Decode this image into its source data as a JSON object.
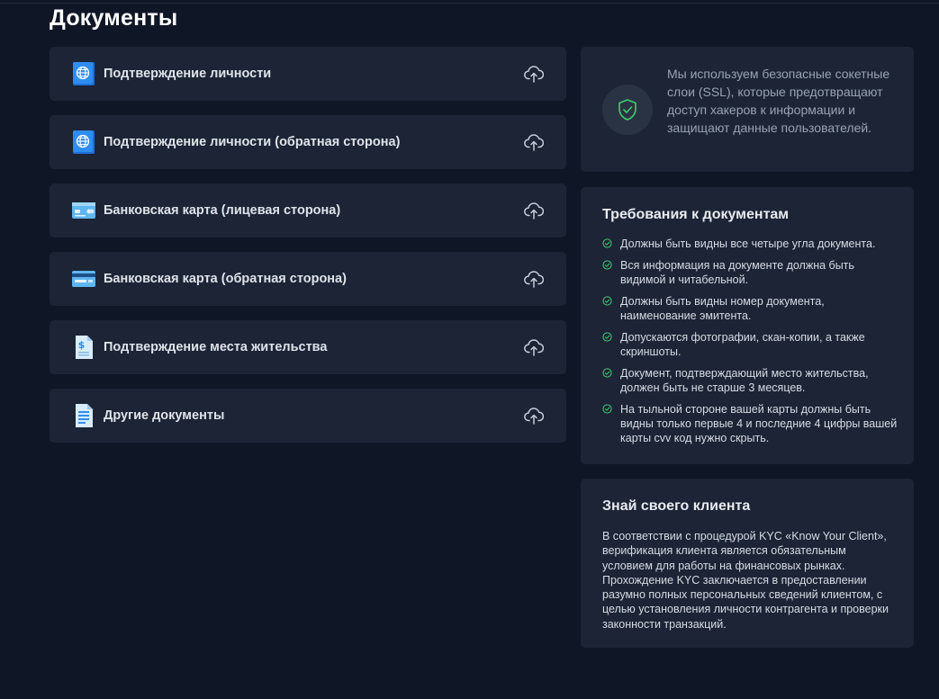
{
  "page": {
    "title": "Документы"
  },
  "documents": [
    {
      "label": "Подтверждение личности",
      "icon": "globe-icon"
    },
    {
      "label": "Подтверждение личности (обратная сторона)",
      "icon": "globe-icon"
    },
    {
      "label": "Банковская карта (лицевая сторона)",
      "icon": "card-front-icon"
    },
    {
      "label": "Банковская карта (обратная сторона)",
      "icon": "card-back-icon"
    },
    {
      "label": "Подтверждение места жительства",
      "icon": "dollar-document-icon"
    },
    {
      "label": "Другие документы",
      "icon": "document-icon"
    }
  ],
  "ssl": {
    "text": "Мы используем безопасные сокетные слои (SSL), которые предотвращают доступ хакеров к информации и защищают данные пользователей."
  },
  "requirements": {
    "title": "Требования к документам",
    "items": [
      "Должны быть видны все четыре угла документа.",
      "Вся информация на документе должна быть видимой и читабельной.",
      "Должны быть видны номер документа, наименование эмитента.",
      "Допускаются фотографии, скан-копии, а также скриншоты.",
      "Документ, подтверждающий место жительства, должен быть не старше 3 месяцев.",
      "На тыльной стороне вашей карты должны быть видны только первые 4 и последние 4 цифры вашей карты cvv код нужно скрыть."
    ]
  },
  "kyc": {
    "title": "Знай своего клиента",
    "text": "В соответствии с процедурой KYC «Know Your Client», верификация клиента является обязательным условием для работы на финансовых рынках. Прохождение KYC заключается в предоставлении разумно полных персональных сведений клиентом, с целью установления личности контрагента и проверки законности транзакций."
  },
  "colors": {
    "background": "#0f1626",
    "card": "#1c2436",
    "accent_green": "#3ecf6e",
    "icon_blue": "#1e88e5"
  }
}
